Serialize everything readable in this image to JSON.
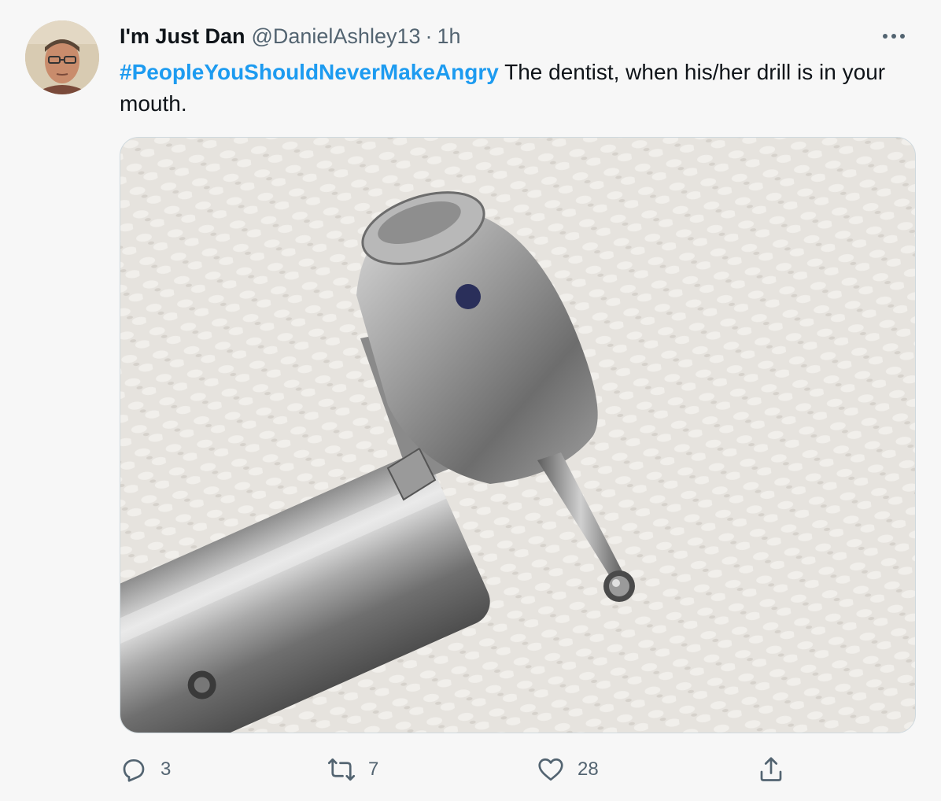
{
  "tweet": {
    "display_name": "I'm Just Dan",
    "handle": "@DanielAshley13",
    "separator": "·",
    "time": "1h",
    "hashtag": "#PeopleYouShouldNeverMakeAngry",
    "text": " The dentist, when his/her drill is in your mouth.",
    "more_label": "•••"
  },
  "actions": {
    "reply_count": "3",
    "retweet_count": "7",
    "like_count": "28"
  },
  "colors": {
    "accent": "#1d9bf0",
    "secondary_text": "#536471",
    "border": "#cfd9de"
  },
  "icons": {
    "reply": "reply-icon",
    "retweet": "retweet-icon",
    "like": "heart-icon",
    "share": "share-icon",
    "more": "more-icon"
  }
}
